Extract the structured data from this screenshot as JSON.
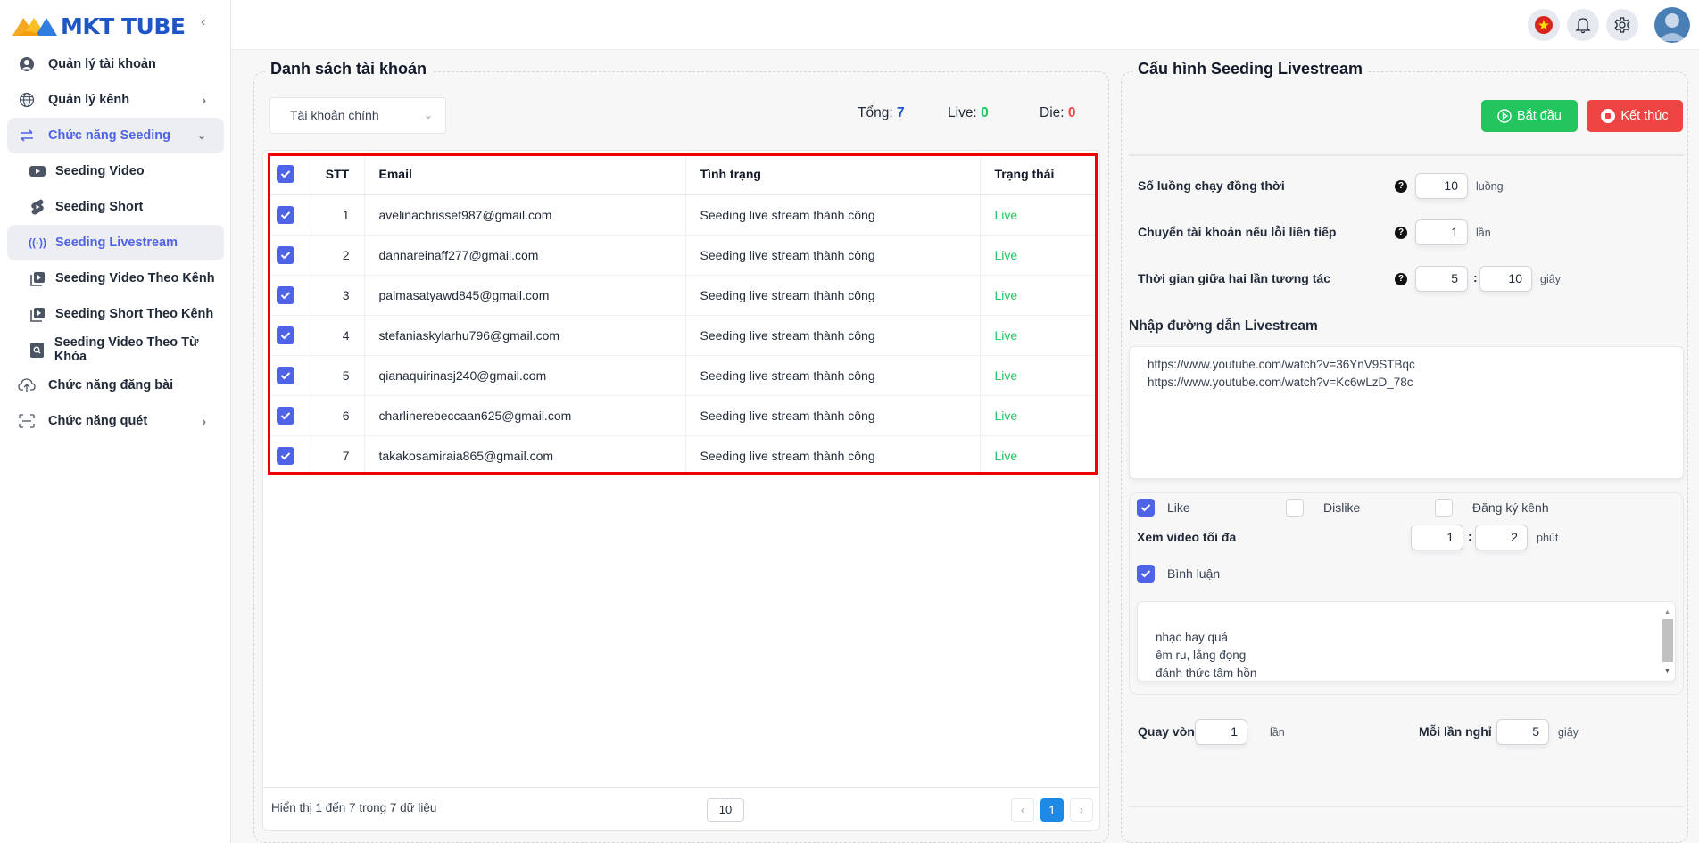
{
  "brand": {
    "name": "MKT TUBE",
    "accent": "#4f63e6"
  },
  "sidebar": {
    "items": [
      {
        "label": "Quản lý tài khoản",
        "icon": "user-circle-icon"
      },
      {
        "label": "Quản lý kênh",
        "icon": "globe-icon",
        "chevron": "right"
      },
      {
        "label": "Chức năng Seeding",
        "icon": "swap-arrows-icon",
        "chevron": "down",
        "expanded": true
      },
      {
        "label": "Seeding Video",
        "icon": "youtube-play-icon"
      },
      {
        "label": "Seeding Short",
        "icon": "shorts-icon"
      },
      {
        "label": "Seeding Livestream",
        "icon": "broadcast-icon",
        "active": true
      },
      {
        "label": "Seeding Video Theo Kênh",
        "icon": "playlist-play-icon"
      },
      {
        "label": "Seeding Short Theo Kênh",
        "icon": "playlist-play-icon"
      },
      {
        "label": "Seeding Video Theo Từ Khóa",
        "icon": "search-doc-icon"
      },
      {
        "label": "Chức năng đăng bài",
        "icon": "cloud-upload-icon"
      },
      {
        "label": "Chức năng quét",
        "icon": "scan-icon",
        "chevron": "right"
      }
    ]
  },
  "header": {
    "icons": [
      "vietnam-flag-icon",
      "bell-icon",
      "gear-icon",
      "avatar"
    ]
  },
  "accounts": {
    "title": "Danh sách tài khoản",
    "filter": {
      "selected": "Tài khoản chính"
    },
    "stats": {
      "total_label": "Tổng:",
      "total": "7",
      "live_label": "Live:",
      "live": "0",
      "die_label": "Die:",
      "die": "0"
    },
    "columns": [
      "STT",
      "Email",
      "Tình trạng",
      "Trạng thái"
    ],
    "rows": [
      {
        "stt": "1",
        "email": "avelinachrisset987@gmail.com",
        "status": "Seeding live stream thành công",
        "state": "Live",
        "checked": true
      },
      {
        "stt": "2",
        "email": "dannareinaff277@gmail.com",
        "status": "Seeding live stream thành công",
        "state": "Live",
        "checked": true
      },
      {
        "stt": "3",
        "email": "palmasatyawd845@gmail.com",
        "status": "Seeding live stream thành công",
        "state": "Live",
        "checked": true
      },
      {
        "stt": "4",
        "email": "stefaniaskylarhu796@gmail.com",
        "status": "Seeding live stream thành công",
        "state": "Live",
        "checked": true
      },
      {
        "stt": "5",
        "email": "qianaquirinasj240@gmail.com",
        "status": "Seeding live stream thành công",
        "state": "Live",
        "checked": true
      },
      {
        "stt": "6",
        "email": "charlinerebeccaan625@gmail.com",
        "status": "Seeding live stream thành công",
        "state": "Live",
        "checked": true
      },
      {
        "stt": "7",
        "email": "takakosamiraia865@gmail.com",
        "status": "Seeding live stream thành công",
        "state": "Live",
        "checked": true
      }
    ],
    "footer": {
      "info": "Hiển thị 1 đến 7 trong 7 dữ liệu",
      "page_size": "10",
      "prev": "‹",
      "current_page": "1",
      "next": "›"
    }
  },
  "config": {
    "title": "Cấu hình Seeding Livestream",
    "start_label": "Bắt đầu",
    "stop_label": "Kết thúc",
    "threads": {
      "label": "Số luồng chạy đồng thời",
      "value": "10",
      "unit": "luồng"
    },
    "switch_on_error": {
      "label": "Chuyển tài khoản nếu lỗi liên tiếp",
      "value": "1",
      "unit": "lần"
    },
    "interval": {
      "label": "Thời gian giữa hai lần tương tác",
      "min": "5",
      "max": "10",
      "unit": "giây"
    },
    "links_label": "Nhập đường dẫn Livestream",
    "links": "https://www.youtube.com/watch?v=36YnV9STBqc\nhttps://www.youtube.com/watch?v=Kc6wLzD_78c",
    "like": {
      "label": "Like",
      "checked": true
    },
    "dislike": {
      "label": "Dislike",
      "checked": false
    },
    "subscribe": {
      "label": "Đăng ký kênh",
      "checked": false
    },
    "watch": {
      "label": "Xem video tối đa",
      "min": "1",
      "max": "2",
      "unit": "phút"
    },
    "comment": {
      "label": "Bình luận",
      "checked": true
    },
    "comments": "nhạc hay quá\nêm ru, lắng đọng\nđánh thức tâm hồn\nyêu đời thông qua bài hát",
    "loop": {
      "label": "Quay vòng",
      "value": "1",
      "unit": "lần"
    },
    "rest": {
      "label": "Mỗi lần nghỉ",
      "value": "5",
      "unit": "giây"
    }
  },
  "colors": {
    "live": "#22c55e",
    "die": "#ef4444",
    "total": "#1e56c8",
    "start_button": "#22c55e",
    "stop_button": "#ef4444",
    "highlight_border": "#f00000",
    "pagination_active": "#1e88e5"
  }
}
